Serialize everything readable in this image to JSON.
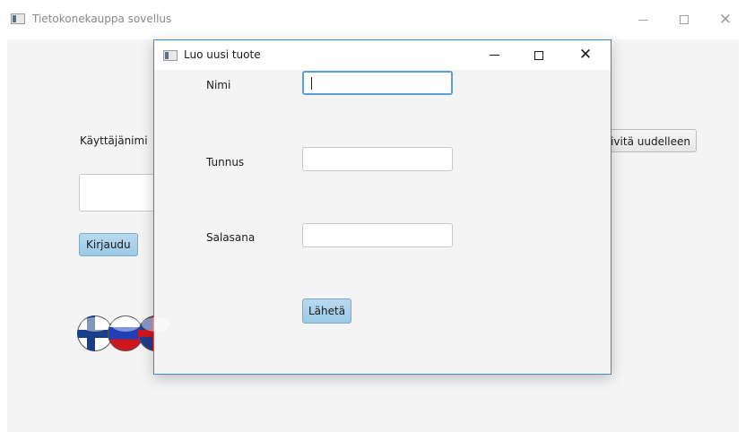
{
  "main_window": {
    "title": "Tietokonekauppa sovellus",
    "username_label": "Käyttäjänimi",
    "username_value": "",
    "login_button": "Kirjaudu",
    "reload_button": "Päivitä uudelleen",
    "flags": [
      "finland-flag-icon",
      "russia-flag-icon",
      "uk-flag-icon"
    ],
    "close_glyph": "✕"
  },
  "dialog": {
    "title": "Luo uusi tuote",
    "close_glyph": "✕",
    "fields": {
      "name_label": "Nimi",
      "name_value": "",
      "code_label": "Tunnus",
      "code_value": "",
      "password_label": "Salasana",
      "password_value": ""
    },
    "send_button": "Lähetä"
  },
  "colors": {
    "accent_border": "#3c88c8",
    "focus_border": "#5aa0d6",
    "button_blue": "#9ccae6",
    "content_bg": "#f4f4f4"
  }
}
